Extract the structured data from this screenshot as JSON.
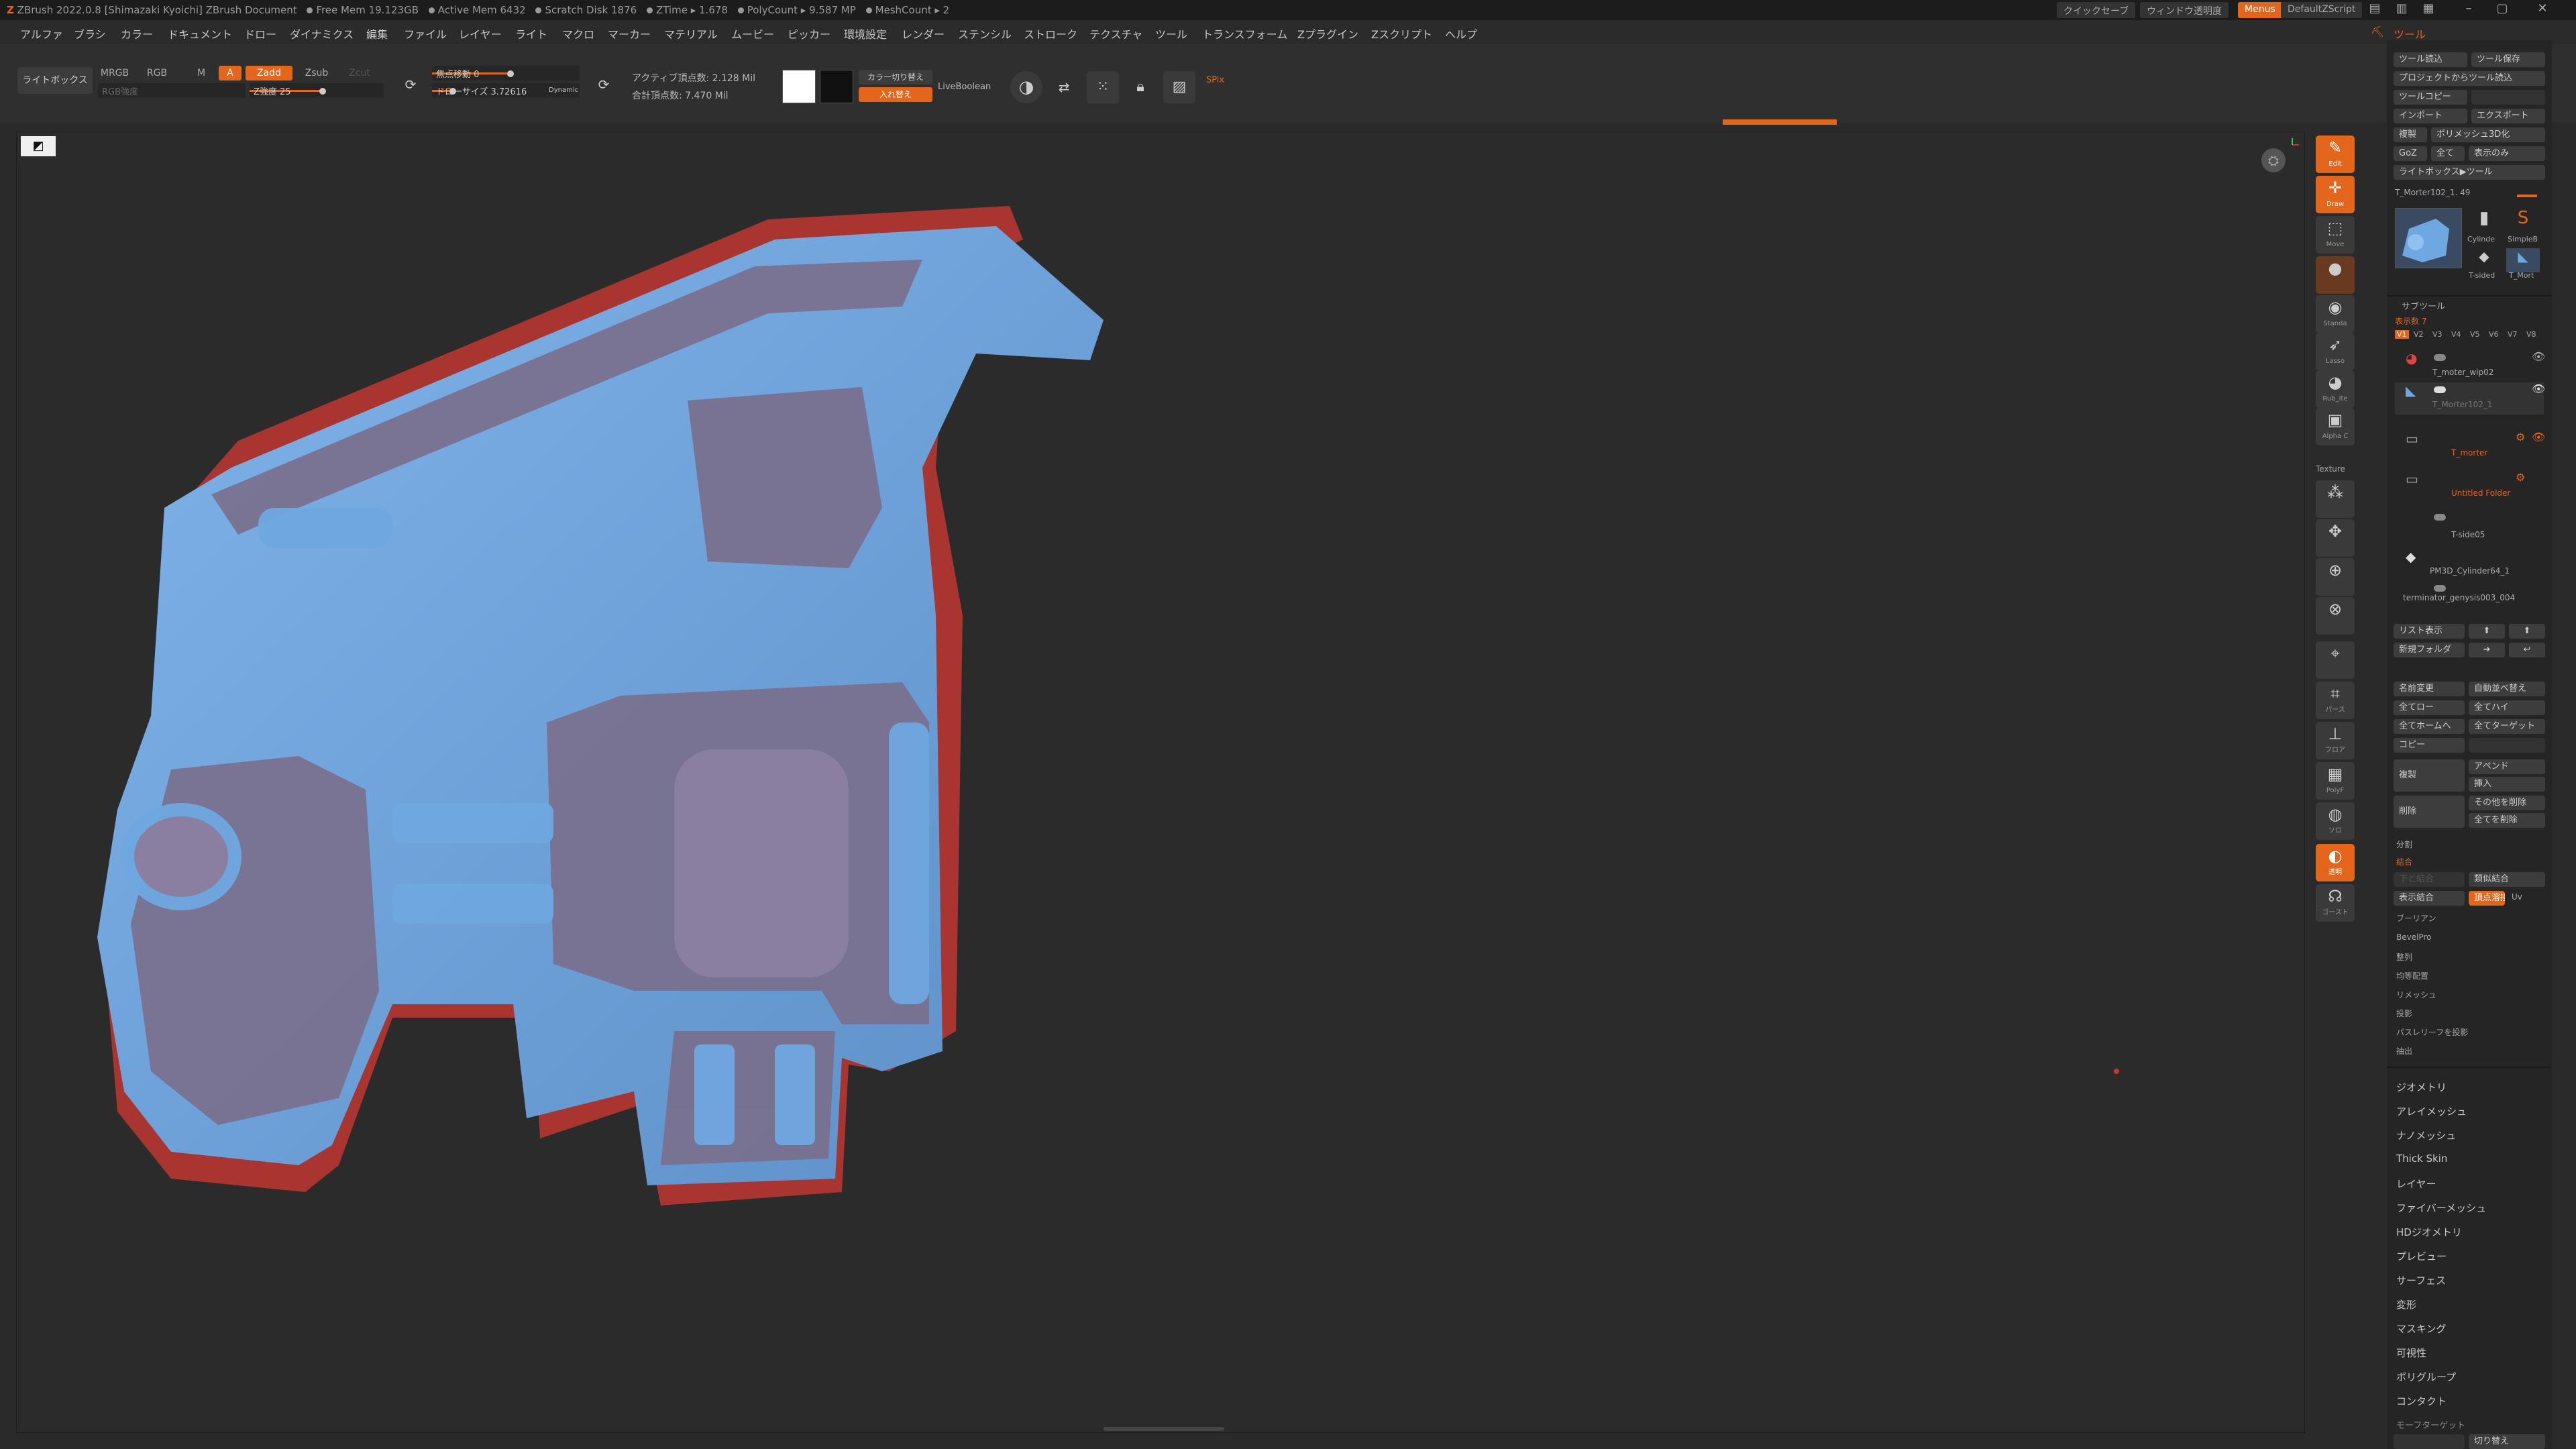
{
  "app": {
    "title": "ZBrush 2022.0.8 [Shimazaki Kyoichi]   ZBrush Document",
    "stats": [
      "Free Mem 19.123GB",
      "Active Mem 6432",
      "Scratch Disk 1876",
      "ZTime ▸ 1.678",
      "PolyCount ▸ 9.587 MP",
      "MeshCount ▸ 2"
    ],
    "quicksave": "クイックセーブ",
    "transparency": "ウィンドウ透明度",
    "menus": "Menus",
    "script": "DefaultZScript",
    "accent": "#e4661d"
  },
  "menubar": {
    "items": [
      "アルファ",
      "ブラシ",
      "カラー",
      "ドキュメント",
      "ドロー",
      "ダイナミクス",
      "編集",
      "ファイル",
      "レイヤー",
      "ライト",
      "マクロ",
      "マーカー",
      "マテリアル",
      "ムービー",
      "ピッカー",
      "環境設定",
      "レンダー",
      "ステンシル",
      "ストローク",
      "テクスチャ",
      "ツール",
      "トランスフォーム",
      "Zプラグイン",
      "Zスクリプト",
      "ヘルプ"
    ],
    "tool_tab": "ツール"
  },
  "toolstrip": {
    "lightbox": "ライトボックス",
    "mrgb": "MRGB",
    "rgb": "RGB",
    "m": "M",
    "a": "A",
    "zadd": "Zadd",
    "zsub": "Zsub",
    "zcut": "Zcut",
    "rgb_intensity": "RGB強度",
    "z_intensity": "Z強度 25",
    "focal_shift": "焦点移動 0",
    "draw_size": "ドローサイズ 3.72616",
    "dynamic": "Dynamic",
    "active_points": "アクティブ頂点数: 2.128 Mil",
    "total_points": "合計頂点数: 7.470 Mil",
    "color_switch": "カラー切り替え",
    "swap": "入れ替え",
    "liveboolean": "LiveBoolean",
    "spix": "SPix"
  },
  "viewport": {
    "model_colors": {
      "front": "#6fa8e0",
      "back": "#b33a34",
      "blend": "#7a6e8c"
    }
  },
  "rightshelf": [
    {
      "name": "edit",
      "glyph": "✎",
      "label": "Edit",
      "on": true
    },
    {
      "name": "draw",
      "glyph": "✛",
      "label": "Draw",
      "on": true
    },
    {
      "name": "move",
      "glyph": "⬚",
      "label": "Move",
      "on": false
    },
    {
      "name": "material",
      "glyph": "●",
      "label": "",
      "on": false
    },
    {
      "name": "standard",
      "glyph": "◉",
      "label": "Standa",
      "on": false
    },
    {
      "name": "lasso",
      "glyph": "➶",
      "label": "Lasso",
      "on": false
    },
    {
      "name": "rub",
      "glyph": "◕",
      "label": "Rub_Ite",
      "on": false
    },
    {
      "name": "alpha",
      "glyph": "▣",
      "label": "Alpha C",
      "on": false
    },
    {
      "name": "tex1",
      "glyph": "⁂",
      "label": "",
      "on": false
    },
    {
      "name": "tex2",
      "glyph": "✥",
      "label": "",
      "on": false
    },
    {
      "name": "tex3",
      "glyph": "⊕",
      "label": "",
      "on": false
    },
    {
      "name": "tex4",
      "glyph": "⊗",
      "label": "",
      "on": false
    },
    {
      "name": "sel",
      "glyph": "⌖",
      "label": "",
      "on": false
    },
    {
      "name": "persp",
      "glyph": "⌗",
      "label": "パース",
      "on": false
    },
    {
      "name": "floor",
      "glyph": "⊥",
      "label": "フロア",
      "on": false
    },
    {
      "name": "polyf",
      "glyph": "▦",
      "label": "PolyF",
      "on": false
    },
    {
      "name": "solo",
      "glyph": "◍",
      "label": "ソロ",
      "on": false
    },
    {
      "name": "transp",
      "glyph": "◐",
      "label": "透明",
      "on": true
    },
    {
      "name": "ghost",
      "glyph": "☊",
      "label": "ゴースト",
      "on": false
    }
  ],
  "textures_label": "Texture",
  "toolpanel": {
    "header": "ツール",
    "buttons": [
      [
        "ツール読込",
        "ツール保存"
      ],
      [
        "プロジェクトからツール読込",
        ""
      ],
      [
        "ツールコピー",
        ""
      ],
      [
        "インポート",
        "エクスポート"
      ],
      [
        "複製",
        "ポリメッシュ3D化"
      ],
      [
        "GoZ",
        "全て",
        "表示のみ"
      ],
      [
        "ライトボックス▶ツール",
        ""
      ]
    ],
    "tool_name": "T_Morter102_1. 49",
    "thumbs": [
      "Cylinde",
      "SimpleB",
      "T-sided",
      "T_Mort"
    ],
    "subtool_title": "サブツール",
    "visible_count": "表示数 7",
    "v_tabs": [
      "V1",
      "V2",
      "V3",
      "V4",
      "V5",
      "V6",
      "V7",
      "V8"
    ],
    "subtools": [
      "T_moter_wip02",
      "T_Morter102_1",
      "T_morter",
      "Untitled Folder",
      "T-side05",
      "PM3D_Cylinder64_1",
      "terminator_genysis003_004"
    ],
    "list_view": "リスト表示",
    "new_folder": "新規フォルダ",
    "ops": [
      [
        "名前変更",
        "自動並べ替え"
      ],
      [
        "全てロー",
        "全てハイ"
      ],
      [
        "全てホームへ",
        "全てターゲット"
      ],
      [
        "コピー",
        ""
      ],
      [
        "複製",
        "アペンド"
      ],
      [
        "",
        "挿入"
      ],
      [
        "削除",
        "その他を削除"
      ],
      [
        "",
        "全てを削除"
      ]
    ],
    "split": "分割",
    "merge": "結合",
    "merge_ops": [
      "下と結合",
      "類似結合",
      "表示結合",
      "頂点溶接",
      "Uv"
    ],
    "extra": [
      "ブーリアン",
      "BevelPro",
      "整列",
      "均等配置",
      "リメッシュ",
      "投影",
      "パスレリーフを投影",
      "抽出"
    ],
    "sections": [
      "ジオメトリ",
      "アレイメッシュ",
      "ナノメッシュ",
      "Thick Skin",
      "レイヤー",
      "ファイバーメッシュ",
      "HDジオメトリ",
      "プレビュー",
      "サーフェス",
      "変形",
      "マスキング",
      "可視性",
      "ポリグループ",
      "コンタクト",
      "モーフターゲット"
    ],
    "morph_switch": "切り替え"
  }
}
